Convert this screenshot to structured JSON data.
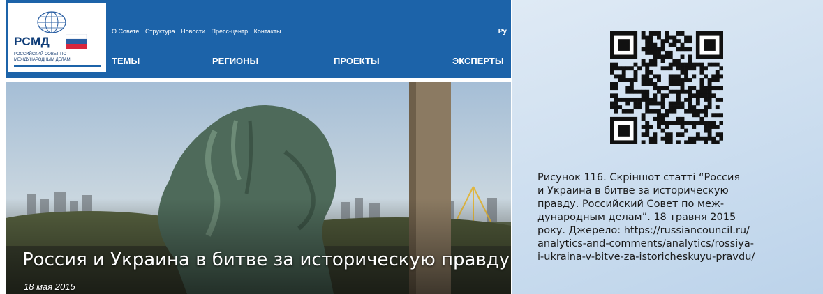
{
  "site": {
    "logo": {
      "abbr": "РСМД",
      "line1": "РОССИЙСКИЙ СОВЕТ ПО",
      "line2": "МЕЖДУНАРОДНЫМ ДЕЛАМ"
    },
    "top_nav": [
      "О Совете",
      "Структура",
      "Новости",
      "Пресс-центр",
      "Контакты"
    ],
    "lang": "Ру",
    "main_nav": [
      "ТЕМЫ",
      "РЕГИОНЫ",
      "ПРОЕКТЫ",
      "ЭКСПЕРТЫ"
    ]
  },
  "article": {
    "title": "Россия и Украина в битве за историческую правду",
    "date": "18 мая 2015"
  },
  "caption": {
    "lines": [
      "Рисунок 116. Скріншот статті “Россия",
      "и Украина в битве за историческую",
      "правду. Российский Совет по меж-",
      "дународным делам”. 18 травня 2015",
      "року. Джерело: https://russiancouncil.ru/",
      "analytics-and-comments/analytics/rossiya-",
      "i-ukraina-v-bitve-za-istoricheskuyu-pravdu/"
    ]
  },
  "colors": {
    "header_blue": "#1c63a9",
    "panel_bg": "#cfe0f1"
  }
}
